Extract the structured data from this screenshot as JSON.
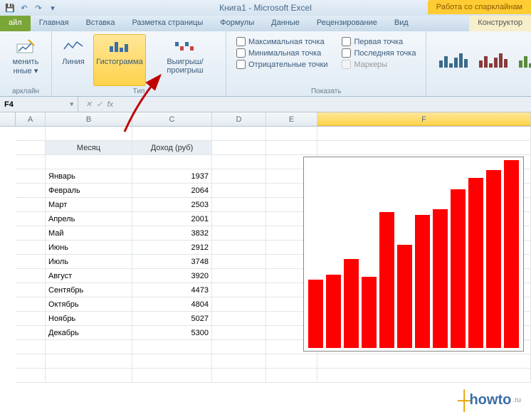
{
  "title": "Книга1 - Microsoft Excel",
  "context_tab": "Работа со спарклайнам",
  "tabs": {
    "file": "айл",
    "home": "Главная",
    "insert": "Вставка",
    "layout": "Разметка страницы",
    "formulas": "Формулы",
    "data": "Данные",
    "review": "Рецензирование",
    "view": "Вид",
    "design": "Конструктор"
  },
  "ribbon": {
    "edit_data": "менить\nнные ▾",
    "group_spark": "арклайн",
    "line": "Линия",
    "column": "Гистограмма",
    "winloss": "Выигрыш/проигрыш",
    "group_type": "Тип",
    "high": "Максимальная точка",
    "low": "Минимальная точка",
    "neg": "Отрицательные точки",
    "first": "Первая точка",
    "last": "Последняя точка",
    "markers": "Маркеры",
    "group_show": "Показать"
  },
  "namebox": "F4",
  "fx": "fx",
  "cols": [
    "A",
    "B",
    "C",
    "D",
    "E",
    "F"
  ],
  "table": {
    "h_month": "Месяц",
    "h_income": "Доход (руб)",
    "rows": [
      {
        "m": "Январь",
        "v": "1937"
      },
      {
        "m": "Февраль",
        "v": "2064"
      },
      {
        "m": "Март",
        "v": "2503"
      },
      {
        "m": "Апрель",
        "v": "2001"
      },
      {
        "m": "Май",
        "v": "3832"
      },
      {
        "m": "Июнь",
        "v": "2912"
      },
      {
        "m": "Июль",
        "v": "3748"
      },
      {
        "m": "Август",
        "v": "3920"
      },
      {
        "m": "Сентябрь",
        "v": "4473"
      },
      {
        "m": "Октябрь",
        "v": "4804"
      },
      {
        "m": "Ноябрь",
        "v": "5027"
      },
      {
        "m": "Декабрь",
        "v": "5300"
      }
    ]
  },
  "watermark": {
    "brand": "howto",
    "suffix": ".ru"
  },
  "chart_data": {
    "type": "bar",
    "categories": [
      "Январь",
      "Февраль",
      "Март",
      "Апрель",
      "Май",
      "Июнь",
      "Июль",
      "Август",
      "Сентябрь",
      "Октябрь",
      "Ноябрь",
      "Декабрь"
    ],
    "values": [
      1937,
      2064,
      2503,
      2001,
      3832,
      2912,
      3748,
      3920,
      4473,
      4804,
      5027,
      5300
    ],
    "ylim": [
      0,
      5300
    ],
    "color": "#ff0000"
  }
}
